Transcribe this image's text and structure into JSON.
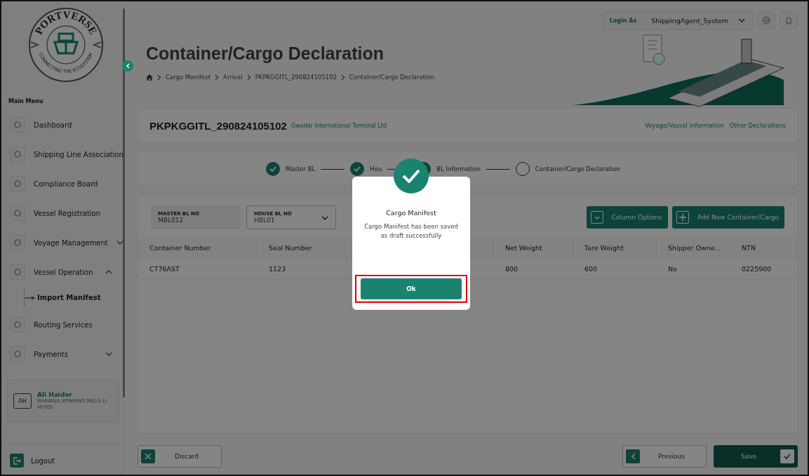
{
  "logo": {
    "title": "PORTVERSE",
    "tagline": "CONNECTING THE ECOSYSTEM"
  },
  "sidebar": {
    "heading": "Main Menu",
    "items": [
      {
        "label": "Dashboard",
        "kind": "link"
      },
      {
        "label": "Shipping Line Association",
        "kind": "link"
      },
      {
        "label": "Compliance Board",
        "kind": "link"
      },
      {
        "label": "Vessel Registration",
        "kind": "link"
      },
      {
        "label": "Voyage Management",
        "kind": "group",
        "expanded": false
      },
      {
        "label": "Vessel Operation",
        "kind": "group",
        "expanded": true,
        "children": [
          {
            "label": "Import Manifest",
            "selected": true
          }
        ]
      },
      {
        "label": "Routing Services",
        "kind": "link"
      },
      {
        "label": "Payments",
        "kind": "group",
        "expanded": false
      }
    ],
    "user": {
      "initials": "AH",
      "name": "Ali Haider",
      "company": "KHAWAJA SPINNING MILLS LI MITED"
    },
    "logout": "Logout"
  },
  "topbar": {
    "login_label": "Login As",
    "account": "ShippingAgent_System"
  },
  "header": {
    "title": "Container/Cargo Declaration",
    "breadcrumb": [
      "Cargo Manifest",
      "Arrival",
      "PKPKGGITL_290824105102",
      "Container/Cargo Declaration"
    ]
  },
  "manifest": {
    "number": "PKPKGGITL_290824105102",
    "terminal": "Gwadar International Terminal Ltd",
    "links": [
      "Voyage/Vessel Information",
      "Other Declarations"
    ]
  },
  "steps": [
    {
      "label": "Master BL",
      "done": true
    },
    {
      "label": "Hou",
      "done": true
    },
    {
      "label": "BL Information",
      "done": true
    },
    {
      "label": "Container/Cargo Declaration",
      "done": false
    }
  ],
  "filters": [
    {
      "label": "MASTER BL NO",
      "value": "MBL012",
      "kind": "readonly"
    },
    {
      "label": "HOUSE BL NO",
      "value": "HBL01",
      "kind": "select"
    }
  ],
  "actions": [
    {
      "label": "Column Options",
      "kind": "dropdown"
    },
    {
      "label": "Add New Container/Cargo",
      "kind": "add"
    }
  ],
  "table": {
    "columns": [
      "Container Number",
      "Seal Number",
      "Net Weight",
      "Tare Weight",
      "Shipper Owne...",
      "NTN"
    ],
    "rows": [
      [
        "CT76AST",
        "1123",
        "800",
        "600",
        "No",
        "0225900"
      ]
    ]
  },
  "footer": {
    "discard": "Discard",
    "previous": "Previous",
    "save": "Save"
  },
  "dialog": {
    "title": "Cargo Manifest",
    "message": "Cargo Manifest has been saved as draft successfully",
    "ok_button": {
      "label": "Ok",
      "highlighted": true
    }
  }
}
